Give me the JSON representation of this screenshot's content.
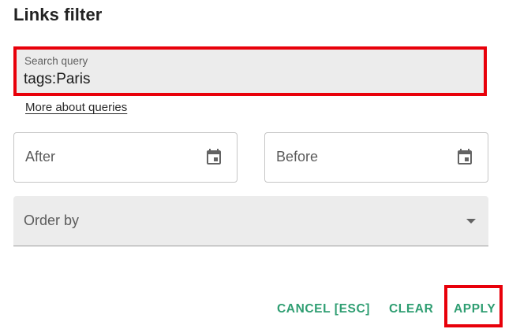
{
  "dialog": {
    "title": "Links filter"
  },
  "search": {
    "label": "Search query",
    "value": "tags:Paris",
    "help_link": "More about queries"
  },
  "date_filters": {
    "after_label": "After",
    "before_label": "Before",
    "icon": "calendar-icon"
  },
  "order": {
    "label": "Order by",
    "icon": "dropdown-arrow-icon"
  },
  "actions": {
    "cancel": "CANCEL [ESC]",
    "clear": "CLEAR",
    "apply": "APPLY"
  },
  "colors": {
    "accent": "#2f9e72",
    "highlight": "#e8000a",
    "field_bg": "#ececec"
  }
}
